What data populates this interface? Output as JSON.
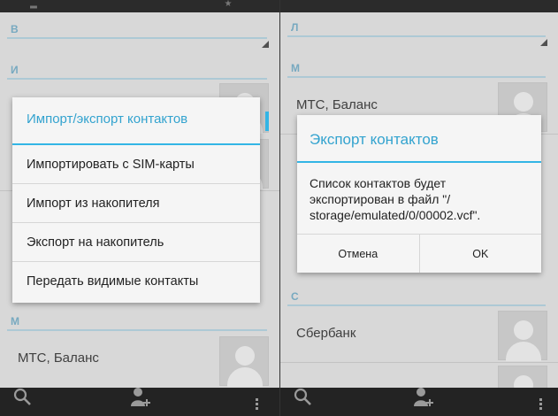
{
  "left": {
    "sections": {
      "v": "В",
      "i": "И",
      "m": "М"
    },
    "contacts": {
      "mts": "МТС, Баланс"
    },
    "dialog": {
      "title": "Импорт/экспорт контактов",
      "items": [
        "Импортировать с SIM-карты",
        "Импорт из накопителя",
        "Экспорт на накопитель",
        "Передать видимые контакты"
      ]
    }
  },
  "right": {
    "sections": {
      "l": "Л",
      "m": "М",
      "s": "С"
    },
    "contacts": {
      "mts": "МТС, Баланс",
      "sber": "Сбербанк"
    },
    "dialog": {
      "title": "Экспорт контактов",
      "message_line1": "Список контактов будет",
      "message_line2": "экспортирован в файл \"/",
      "message_line3": "storage/emulated/0/00002.vcf\".",
      "cancel_label": "Отмена",
      "ok_label": "OK"
    }
  },
  "colors": {
    "accent": "#33b5e5",
    "section_text": "#7fb4cc",
    "bottom_bar": "#232323"
  },
  "icons": {
    "search": "search-icon",
    "add_contact": "add-contact-icon",
    "menu": "overflow-menu-icon"
  }
}
